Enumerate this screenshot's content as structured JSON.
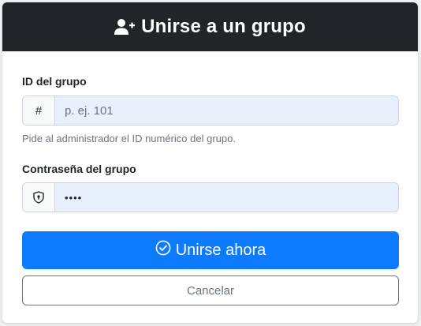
{
  "header": {
    "title": "Unirse a un grupo",
    "icon": "user-plus-icon"
  },
  "group_id": {
    "label": "ID del grupo",
    "prefix": "#",
    "placeholder": "p. ej. 101",
    "value": "",
    "help": "Pide al administrador el ID numérico del grupo."
  },
  "password": {
    "label": "Contraseña del grupo",
    "icon": "shield-lock-icon",
    "value": "••••"
  },
  "buttons": {
    "join_label": "Unirse ahora",
    "join_icon": "check-circle-icon",
    "cancel_label": "Cancelar"
  },
  "colors": {
    "header_bg": "#212529",
    "primary": "#0d7bff",
    "input_bg": "#e8f0fe",
    "muted": "#6c757d"
  }
}
